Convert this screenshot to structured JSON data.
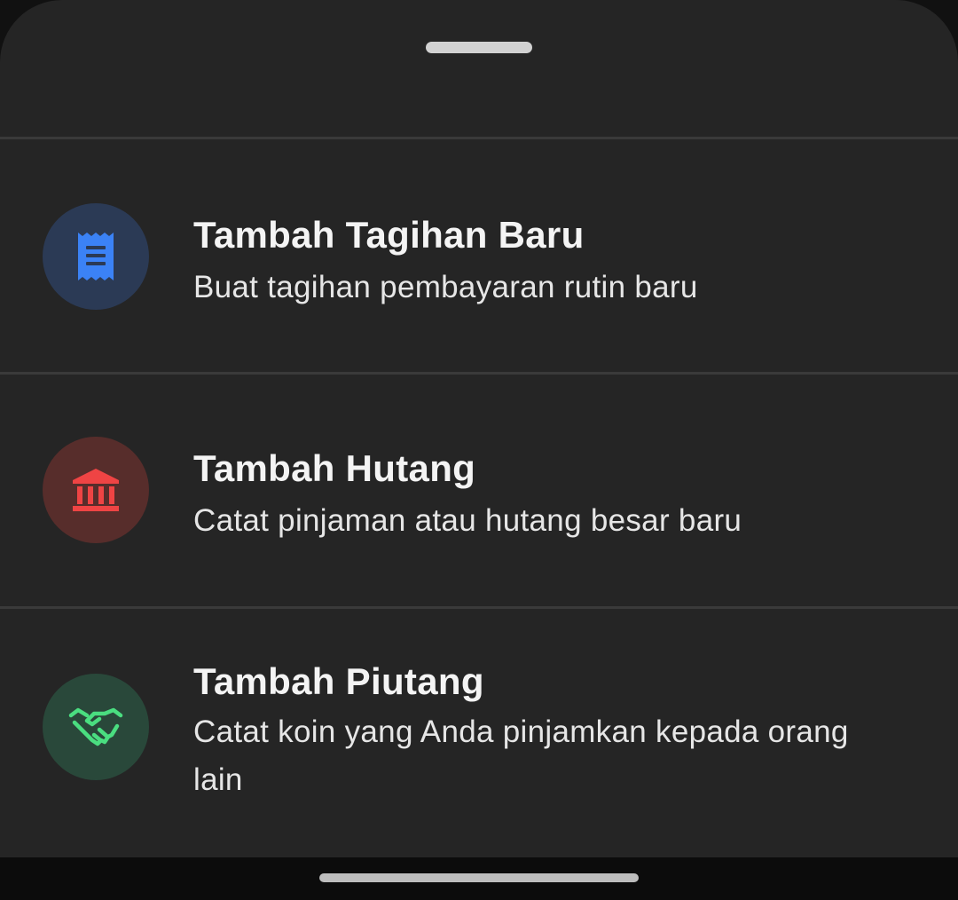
{
  "sheet": {
    "options": [
      {
        "title": "Tambah Tagihan Baru",
        "subtitle": "Buat tagihan pembayaran rutin baru",
        "icon": "receipt-icon",
        "icon_color": "#3b82f6",
        "icon_bg": "#2b3a55"
      },
      {
        "title": "Tambah Hutang",
        "subtitle": "Catat pinjaman atau hutang besar baru",
        "icon": "bank-icon",
        "icon_color": "#ef4444",
        "icon_bg": "#572d2b"
      },
      {
        "title": "Tambah Piutang",
        "subtitle": "Catat koin yang Anda pinjamkan kepada orang lain",
        "icon": "handshake-icon",
        "icon_color": "#4ade80",
        "icon_bg": "#29483a"
      }
    ]
  }
}
